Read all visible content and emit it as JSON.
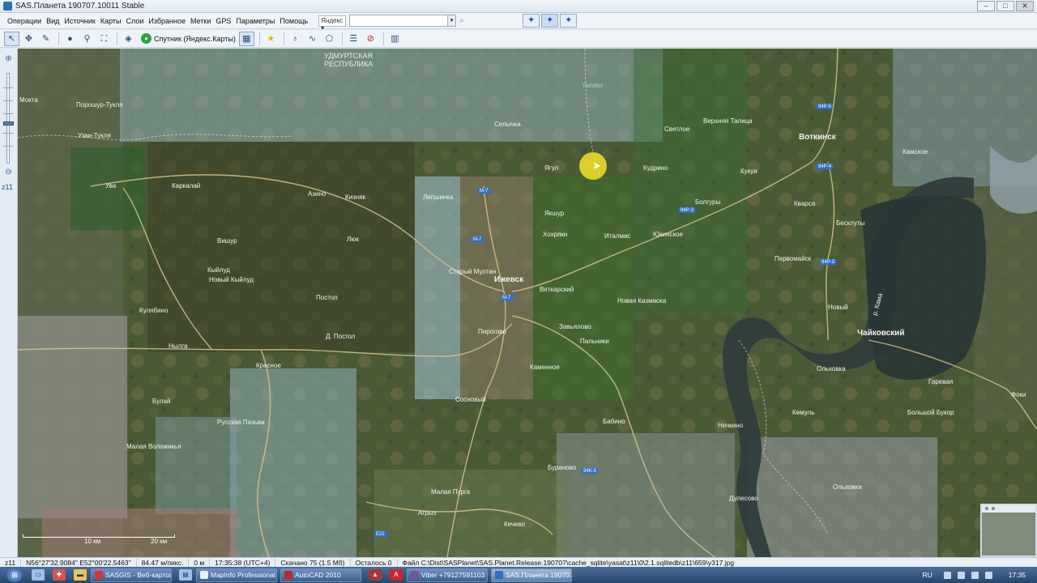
{
  "window": {
    "title": "SAS.Планета 190707.10011 Stable"
  },
  "menu": {
    "items": [
      "Операции",
      "Вид",
      "Источник",
      "Карты",
      "Слои",
      "Избранное",
      "Метки",
      "GPS",
      "Параметры",
      "Помощь"
    ],
    "search_provider": "Яндекс",
    "search_value": ""
  },
  "toolbar": {
    "map_source_label": "Спутник (Яндекс.Карты)"
  },
  "zoom": {
    "level_label": "z11",
    "level": 11
  },
  "map": {
    "region_label": "УДМУРТСКАЯ\nРЕСПУБЛИКА",
    "cities": [
      {
        "name": "Ижевск",
        "kind": "city"
      },
      {
        "name": "Воткинск",
        "kind": "city"
      },
      {
        "name": "Чайковский",
        "kind": "city"
      },
      {
        "name": "Ува",
        "kind": "town"
      }
    ],
    "villages": [
      "Порошур-Тукля",
      "Узви-Тукля",
      "Каркалай",
      "Азино",
      "Кизняк",
      "Вишур",
      "Люк",
      "Кыйлуд",
      "Новый Кыйлуд",
      "Постол",
      "Кулябино",
      "Д. Постол",
      "Нылга",
      "Красное",
      "Булай",
      "Русская Пазьва",
      "Малая Воложикья",
      "Селычка",
      "Якшур",
      "Хохряки",
      "Италмас",
      "Вяткарский",
      "Старый Мултан",
      "Пирогово",
      "Завьялово",
      "Пальники",
      "Каменное",
      "Бабино",
      "Сосновый",
      "Новая Казмаска",
      "Юкинское",
      "Болгуры",
      "Кварса",
      "Бесклуты",
      "Первомайск",
      "Новый",
      "Ольховка",
      "Камское",
      "Гаревая",
      "Фоки",
      "Кемуль",
      "Большой Букор",
      "Нечкино",
      "Дулесово",
      "Ольховка",
      "Малая Пурга",
      "Агрыз",
      "Кечево",
      "Бураново",
      "Ягул",
      "Лепшинка",
      "Светлое",
      "Кудрино",
      "Верхняя Талица",
      "Кукуи",
      "Мокта"
    ],
    "road_signs": [
      "M-7",
      "M-7",
      "M-7",
      "94P-3",
      "94P-4",
      "94P-5",
      "94P-3",
      "94K-5",
      "E22"
    ],
    "river_label": "р. Кама",
    "watermark": "Yandex",
    "scale": {
      "left_label": "10 км",
      "right_label": "20 км"
    }
  },
  "status": {
    "zoom": "z11",
    "coords": "N56°27'32.9084\" E52°00'22.5463\"",
    "resolution": "84.47 м/пикс.",
    "distance": "0 м",
    "time": "17:35:38 (UTC+4)",
    "downloaded": "Скачано 75 (1.5 Мб)",
    "remaining": "Осталось 0",
    "file": "Файл C:\\Dist\\SASPlanet\\SAS.Planet.Release.190707\\cache_sqlite\\yasat\\z11\\0\\2.1.sqlitedb\\z11\\659\\y317.jpg"
  },
  "taskbar": {
    "buttons": [
      {
        "label": "SASGIS - Веб-картог...",
        "active": false
      },
      {
        "label": "MapInfo Professional",
        "active": false
      },
      {
        "label": "AutoCAD 2010",
        "active": false
      },
      {
        "label": "Viber +79127591103",
        "active": false
      },
      {
        "label": "SAS.Планета 190707...",
        "active": true
      }
    ],
    "lang": "RU",
    "clock": "17:35"
  }
}
